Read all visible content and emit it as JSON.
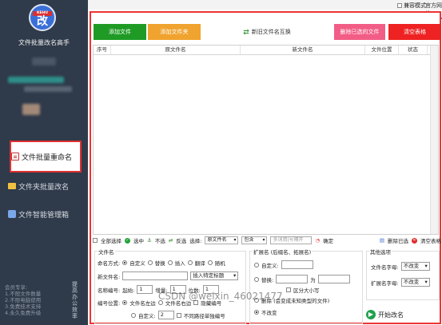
{
  "sidebar": {
    "app_title": "文件批量改名高手",
    "logo_char": "改",
    "logo_ribbon": "KEHU",
    "nav": {
      "file_rename": "文件批量重命名",
      "folder_rename": "文件夹批量改名",
      "smart_box": "文件智能管理箱"
    },
    "member_title": "会员专享:",
    "member_lines": [
      "1.不限文件数量",
      "2.不限电脑使用",
      "3.免费技术支持",
      "4.永久免费升级"
    ],
    "vertical_text": "提高办公效率"
  },
  "topbar": {
    "compat_mode": "兼容模式",
    "official_site": "官方网站"
  },
  "toolbar": {
    "add_file": "添加文件",
    "add_folder": "添加文件夹",
    "new_name_swap": "新旧文件名互换",
    "delete_selected": "删除已选的文件",
    "clear_table": "清空表格"
  },
  "table": {
    "columns": [
      "序号",
      "原文件名",
      "新文件名",
      "文件位置",
      "状态"
    ]
  },
  "selbar": {
    "select_all": "全部选择",
    "select": "选中",
    "deselect": "不选",
    "invert": "反选",
    "choose_label": "选择:",
    "choose_value": "原文件名",
    "match_value": "包含",
    "keyword_placeholder": "多词用|号隔开",
    "confirm": "确定",
    "delete_checked": "删除已选",
    "clear_table": "清空表格"
  },
  "name_panel": {
    "title": "文件名",
    "rename_mode_label": "命名方式:",
    "modes": [
      "自定义",
      "替换",
      "插入",
      "翻译",
      "随机"
    ],
    "new_name_label": "新文件名:",
    "insert_tag": "插入特定标题",
    "numbering_label": "名称编号:",
    "start_label": "起始:",
    "start_value": "1",
    "step_label": "增量:",
    "step_value": "1",
    "digits_label": "位数:",
    "digits_value": "1",
    "pos_label": "编号位置:",
    "pos_left": "文件名左边",
    "pos_right": "文件名右边",
    "hide_number": "隐藏编号",
    "custom_label": "自定义:",
    "custom_value": "2",
    "no_single_number": "不同路径单独编号"
  },
  "ext_panel": {
    "title": "扩展名 (后缀名、拓展名)",
    "custom": "自定义:",
    "replace": "替换:",
    "to": "为",
    "case_sensitive": "区分大小写",
    "delete_ext": "删除 (会变成未知类型的文件)",
    "no_change": "不改变"
  },
  "other_panel": {
    "title": "其他选项",
    "filename_case_label": "文件名字母:",
    "filename_case_value": "不改变",
    "ext_case_label": "扩展名字母:",
    "ext_case_value": "不改变"
  },
  "start_rename": "开始改名",
  "watermark": "CSDN @weixin_46021477",
  "colors": {
    "sidebar_bg": "#2f3a4a",
    "add_file": "#1f9b25",
    "add_folder": "#f0a32e",
    "delete_selected": "#f25d86",
    "clear_table": "#ee2222",
    "highlight_border": "#e33333"
  }
}
